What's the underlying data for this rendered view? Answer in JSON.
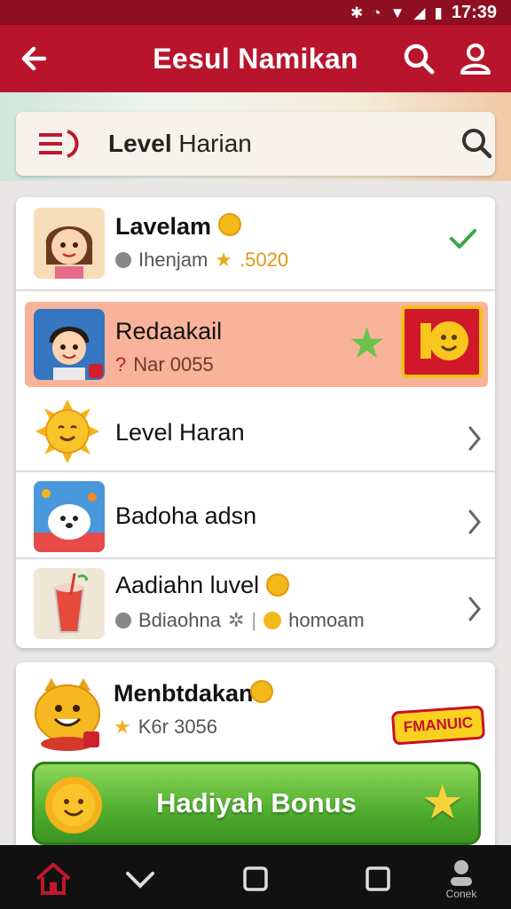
{
  "status_bar": {
    "time": "17:39"
  },
  "app_bar": {
    "title": "Eesul Namikan"
  },
  "search_card": {
    "label_bold": "Level",
    "label_rest": " Harian"
  },
  "list": {
    "items": [
      {
        "name": "Lavelam",
        "sub": "Ihenjam",
        "value": ".5020"
      },
      {
        "name": "Redaakail",
        "sub": "Nar 0055",
        "prefix": "?"
      },
      {
        "name": "Level Haran"
      },
      {
        "name": "Badoha adsn"
      },
      {
        "name": "Aadiahn luvel",
        "sub1": "Bdiaohna",
        "sub2": "homoam"
      }
    ]
  },
  "bottom_card": {
    "name": "Menbtdakan",
    "sub": "K6r 3056",
    "promo": "FMANUIC",
    "bonus_label": "Hadiyah Bonus"
  },
  "nav_bar": {
    "label": "Conek"
  },
  "colors": {
    "primary": "#b8152d",
    "status": "#8e0f22",
    "highlight": "#f8b39a",
    "green": "#4fae2e"
  }
}
